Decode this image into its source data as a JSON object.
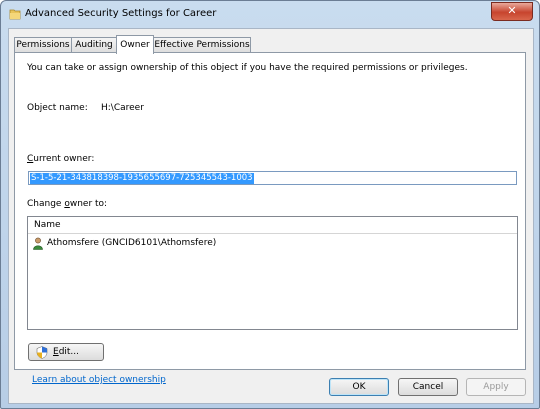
{
  "window": {
    "title": "Advanced Security Settings for Career",
    "close_label": "✕"
  },
  "tabs": [
    {
      "label": "Permissions",
      "active": false
    },
    {
      "label": "Auditing",
      "active": false
    },
    {
      "label": "Owner",
      "active": true
    },
    {
      "label": "Effective Permissions",
      "active": false
    }
  ],
  "owner_tab": {
    "intro": "You can take or assign ownership of this object if you have the required permissions or privileges.",
    "object_name_label": "Object name:",
    "object_name_value": "H:\\Career",
    "current_owner_label_accel": "C",
    "current_owner_label_rest": "urrent owner:",
    "current_owner_value": "S-1-5-21-343818398-1935655697-725345543-1003",
    "change_owner_label_pre": "Change ",
    "change_owner_label_accel": "o",
    "change_owner_label_rest": "wner to:",
    "list_header": "Name",
    "owners": [
      {
        "name": "Athomsfere (GNCID6101\\Athomsfere)",
        "icon": "user-icon"
      }
    ],
    "edit_accel": "E",
    "edit_rest": "dit...",
    "learn_link": "Learn about object ownership"
  },
  "footer": {
    "ok_label": "OK",
    "cancel_label": "Cancel",
    "apply_label": "Apply"
  },
  "colors": {
    "selection": "#3399ff",
    "link": "#0066cc",
    "title_bar": "#c9dcef"
  }
}
